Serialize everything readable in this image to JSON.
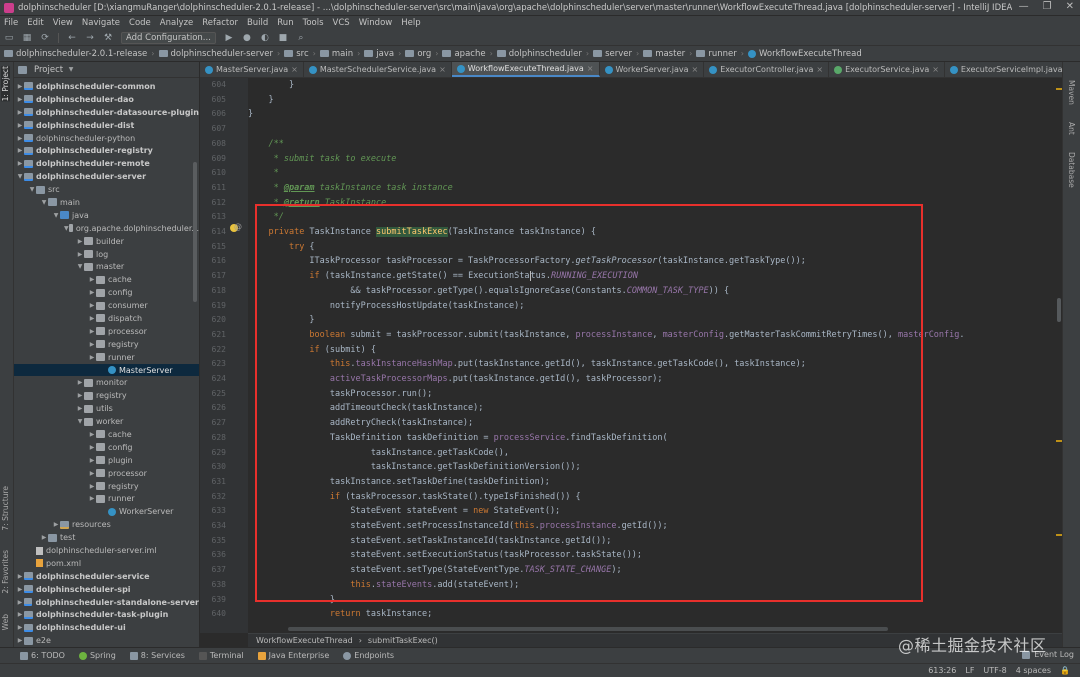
{
  "window": {
    "title": "dolphinscheduler [D:\\xiangmuRanger\\dolphinscheduler-2.0.1-release] - ...\\dolphinscheduler-server\\src\\main\\java\\org\\apache\\dolphinscheduler\\server\\master\\runner\\WorkflowExecuteThread.java [dolphinscheduler-server] - IntelliJ IDEA",
    "controls": [
      "—",
      "❐",
      "✕"
    ]
  },
  "menu": [
    "File",
    "Edit",
    "View",
    "Navigate",
    "Code",
    "Analyze",
    "Refactor",
    "Build",
    "Run",
    "Tools",
    "VCS",
    "Window",
    "Help"
  ],
  "toolbar": {
    "config_label": "Add Configuration..."
  },
  "breadcrumb": [
    "dolphinscheduler-2.0.1-release",
    "dolphinscheduler-server",
    "src",
    "main",
    "java",
    "org",
    "apache",
    "dolphinscheduler",
    "server",
    "master",
    "runner",
    "WorkflowExecuteThread"
  ],
  "left_tabs": [
    "1: Project",
    "7: Structure",
    "2: Favorites",
    "Web"
  ],
  "project": {
    "title": "Project",
    "tree": [
      {
        "depth": 0,
        "label": "dolphinscheduler-common",
        "icon": "mod",
        "arrow": "▶",
        "bold": true
      },
      {
        "depth": 0,
        "label": "dolphinscheduler-dao",
        "icon": "mod",
        "arrow": "▶",
        "bold": true
      },
      {
        "depth": 0,
        "label": "dolphinscheduler-datasource-plugin",
        "icon": "mod",
        "arrow": "▶",
        "bold": true
      },
      {
        "depth": 0,
        "label": "dolphinscheduler-dist",
        "icon": "mod",
        "arrow": "▶",
        "bold": true
      },
      {
        "depth": 0,
        "label": "dolphinscheduler-python",
        "icon": "mod",
        "arrow": "▶",
        "bold": false
      },
      {
        "depth": 0,
        "label": "dolphinscheduler-registry",
        "icon": "mod",
        "arrow": "▶",
        "bold": true
      },
      {
        "depth": 0,
        "label": "dolphinscheduler-remote",
        "icon": "mod",
        "arrow": "▶",
        "bold": true
      },
      {
        "depth": 0,
        "label": "dolphinscheduler-server",
        "icon": "mod",
        "arrow": "▼",
        "bold": true
      },
      {
        "depth": 1,
        "label": "src",
        "icon": "folder",
        "arrow": "▼",
        "bold": false
      },
      {
        "depth": 2,
        "label": "main",
        "icon": "folder",
        "arrow": "▼",
        "bold": false
      },
      {
        "depth": 3,
        "label": "java",
        "icon": "src",
        "arrow": "▼",
        "bold": false
      },
      {
        "depth": 4,
        "label": "org.apache.dolphinscheduler...",
        "icon": "pkg",
        "arrow": "▼",
        "bold": false
      },
      {
        "depth": 5,
        "label": "builder",
        "icon": "pkg",
        "arrow": "▶",
        "bold": false
      },
      {
        "depth": 5,
        "label": "log",
        "icon": "pkg",
        "arrow": "▶",
        "bold": false
      },
      {
        "depth": 5,
        "label": "master",
        "icon": "pkg",
        "arrow": "▼",
        "bold": false
      },
      {
        "depth": 6,
        "label": "cache",
        "icon": "pkg",
        "arrow": "▶",
        "bold": false
      },
      {
        "depth": 6,
        "label": "config",
        "icon": "pkg",
        "arrow": "▶",
        "bold": false
      },
      {
        "depth": 6,
        "label": "consumer",
        "icon": "pkg",
        "arrow": "▶",
        "bold": false
      },
      {
        "depth": 6,
        "label": "dispatch",
        "icon": "pkg",
        "arrow": "▶",
        "bold": false
      },
      {
        "depth": 6,
        "label": "processor",
        "icon": "pkg",
        "arrow": "▶",
        "bold": false
      },
      {
        "depth": 6,
        "label": "registry",
        "icon": "pkg",
        "arrow": "▶",
        "bold": false
      },
      {
        "depth": 6,
        "label": "runner",
        "icon": "pkg",
        "arrow": "▶",
        "bold": false
      },
      {
        "depth": 7,
        "label": "MasterServer",
        "icon": "cls",
        "arrow": "",
        "bold": false,
        "selected": true
      },
      {
        "depth": 5,
        "label": "monitor",
        "icon": "pkg",
        "arrow": "▶",
        "bold": false
      },
      {
        "depth": 5,
        "label": "registry",
        "icon": "pkg",
        "arrow": "▶",
        "bold": false
      },
      {
        "depth": 5,
        "label": "utils",
        "icon": "pkg",
        "arrow": "▶",
        "bold": false
      },
      {
        "depth": 5,
        "label": "worker",
        "icon": "pkg",
        "arrow": "▼",
        "bold": false
      },
      {
        "depth": 6,
        "label": "cache",
        "icon": "pkg",
        "arrow": "▶",
        "bold": false
      },
      {
        "depth": 6,
        "label": "config",
        "icon": "pkg",
        "arrow": "▶",
        "bold": false
      },
      {
        "depth": 6,
        "label": "plugin",
        "icon": "pkg",
        "arrow": "▶",
        "bold": false
      },
      {
        "depth": 6,
        "label": "processor",
        "icon": "pkg",
        "arrow": "▶",
        "bold": false
      },
      {
        "depth": 6,
        "label": "registry",
        "icon": "pkg",
        "arrow": "▶",
        "bold": false
      },
      {
        "depth": 6,
        "label": "runner",
        "icon": "pkg",
        "arrow": "▶",
        "bold": false
      },
      {
        "depth": 7,
        "label": "WorkerServer",
        "icon": "cls",
        "arrow": "",
        "bold": false
      },
      {
        "depth": 3,
        "label": "resources",
        "icon": "res",
        "arrow": "▶",
        "bold": false
      },
      {
        "depth": 2,
        "label": "test",
        "icon": "folder",
        "arrow": "▶",
        "bold": false
      },
      {
        "depth": 1,
        "label": "dolphinscheduler-server.iml",
        "icon": "file",
        "arrow": "",
        "bold": false
      },
      {
        "depth": 1,
        "label": "pom.xml",
        "icon": "xml",
        "arrow": "",
        "bold": false
      },
      {
        "depth": 0,
        "label": "dolphinscheduler-service",
        "icon": "mod",
        "arrow": "▶",
        "bold": true
      },
      {
        "depth": 0,
        "label": "dolphinscheduler-spi",
        "icon": "mod",
        "arrow": "▶",
        "bold": true
      },
      {
        "depth": 0,
        "label": "dolphinscheduler-standalone-server",
        "icon": "mod",
        "arrow": "▶",
        "bold": true
      },
      {
        "depth": 0,
        "label": "dolphinscheduler-task-plugin",
        "icon": "mod",
        "arrow": "▶",
        "bold": true
      },
      {
        "depth": 0,
        "label": "dolphinscheduler-ui",
        "icon": "mod",
        "arrow": "▶",
        "bold": true
      },
      {
        "depth": 0,
        "label": "e2e",
        "icon": "folder",
        "arrow": "▶",
        "bold": false
      }
    ]
  },
  "tabs": [
    {
      "label": "MasterServer.java",
      "active": false
    },
    {
      "label": "MasterSchedulerService.java",
      "active": false
    },
    {
      "label": "WorkflowExecuteThread.java",
      "active": true
    },
    {
      "label": "WorkerServer.java",
      "active": false
    },
    {
      "label": "ExecutorController.java",
      "active": false
    },
    {
      "label": "ExecutorService.java",
      "active": false
    },
    {
      "label": "ExecutorServiceImpl.java",
      "active": false
    }
  ],
  "right_tabs": [
    "Maven",
    "Ant",
    "Database"
  ],
  "editor": {
    "line_numbers": [
      "604",
      "605",
      "606",
      "607",
      "608",
      "609",
      "610",
      "611",
      "612",
      "613",
      "614",
      "615",
      "616",
      "617",
      "618",
      "619",
      "620",
      "621",
      "622",
      "623",
      "624",
      "625",
      "626",
      "627",
      "628",
      "629",
      "630",
      "631",
      "632",
      "633",
      "634",
      "635",
      "636",
      "637",
      "638",
      "639",
      "640"
    ],
    "code_crumbs": [
      "WorkflowExecuteThread",
      "submitTaskExec()"
    ]
  },
  "bottom_tools": [
    {
      "label": "6: TODO"
    },
    {
      "label": "Spring"
    },
    {
      "label": "8: Services"
    },
    {
      "label": "Terminal"
    },
    {
      "label": "Java Enterprise"
    },
    {
      "label": "Endpoints"
    }
  ],
  "event_log": "Event Log",
  "status": {
    "position": "613:26",
    "line_sep": "LF",
    "encoding": "UTF-8",
    "indent": "4 spaces"
  },
  "watermark": "@稀土掘金技术社区"
}
